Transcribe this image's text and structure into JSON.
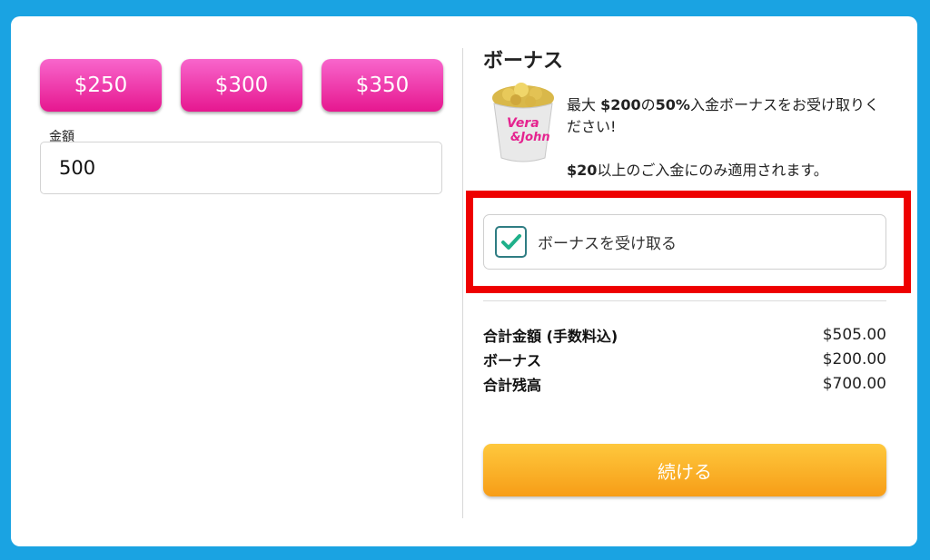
{
  "amount_presets": [
    "$250",
    "$300",
    "$350"
  ],
  "amount": {
    "label": "金額",
    "value": "500"
  },
  "bonus": {
    "title": "ボーナス",
    "desc_prefix": "最大 ",
    "desc_max": "$200",
    "desc_mid": "の",
    "desc_percent": "50%",
    "desc_suffix": "入金ボーナスをお受け取りください!",
    "note_min": "$20",
    "note_suffix": "以上のご入金にのみ適用されます。",
    "brand_line1": "Vera",
    "brand_line2": "&John",
    "checkbox_label": "ボーナスを受け取る",
    "checkbox_checked": true
  },
  "summary": {
    "rows": [
      {
        "label": "合計金額 (手数料込)",
        "value": "$505.00"
      },
      {
        "label": "ボーナス",
        "value": "$200.00"
      },
      {
        "label": "合計残高",
        "value": "$700.00"
      }
    ]
  },
  "continue_label": "続ける",
  "colors": {
    "background": "#1aa3e2",
    "preset_button": "#ee2aa6",
    "continue_button": "#f9ac22",
    "highlight": "#ee0000",
    "check": "#1fb08a"
  }
}
